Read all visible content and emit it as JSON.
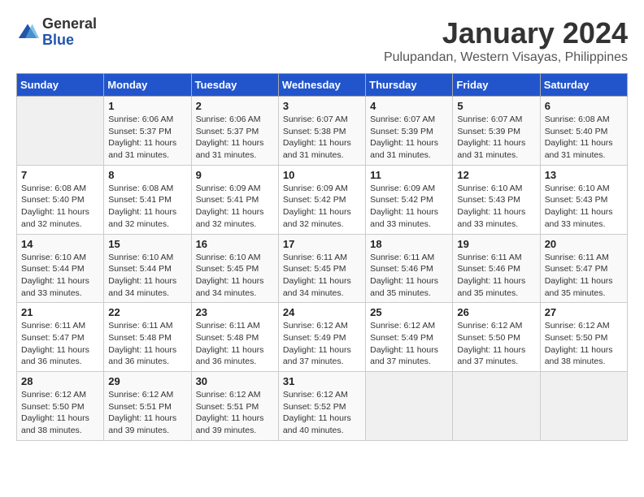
{
  "logo": {
    "general": "General",
    "blue": "Blue"
  },
  "title": {
    "month_year": "January 2024",
    "location": "Pulupandan, Western Visayas, Philippines"
  },
  "days_of_week": [
    "Sunday",
    "Monday",
    "Tuesday",
    "Wednesday",
    "Thursday",
    "Friday",
    "Saturday"
  ],
  "weeks": [
    [
      {
        "day": "",
        "sunrise": "",
        "sunset": "",
        "daylight": ""
      },
      {
        "day": "1",
        "sunrise": "Sunrise: 6:06 AM",
        "sunset": "Sunset: 5:37 PM",
        "daylight": "Daylight: 11 hours and 31 minutes."
      },
      {
        "day": "2",
        "sunrise": "Sunrise: 6:06 AM",
        "sunset": "Sunset: 5:37 PM",
        "daylight": "Daylight: 11 hours and 31 minutes."
      },
      {
        "day": "3",
        "sunrise": "Sunrise: 6:07 AM",
        "sunset": "Sunset: 5:38 PM",
        "daylight": "Daylight: 11 hours and 31 minutes."
      },
      {
        "day": "4",
        "sunrise": "Sunrise: 6:07 AM",
        "sunset": "Sunset: 5:39 PM",
        "daylight": "Daylight: 11 hours and 31 minutes."
      },
      {
        "day": "5",
        "sunrise": "Sunrise: 6:07 AM",
        "sunset": "Sunset: 5:39 PM",
        "daylight": "Daylight: 11 hours and 31 minutes."
      },
      {
        "day": "6",
        "sunrise": "Sunrise: 6:08 AM",
        "sunset": "Sunset: 5:40 PM",
        "daylight": "Daylight: 11 hours and 31 minutes."
      }
    ],
    [
      {
        "day": "7",
        "sunrise": "Sunrise: 6:08 AM",
        "sunset": "Sunset: 5:40 PM",
        "daylight": "Daylight: 11 hours and 32 minutes."
      },
      {
        "day": "8",
        "sunrise": "Sunrise: 6:08 AM",
        "sunset": "Sunset: 5:41 PM",
        "daylight": "Daylight: 11 hours and 32 minutes."
      },
      {
        "day": "9",
        "sunrise": "Sunrise: 6:09 AM",
        "sunset": "Sunset: 5:41 PM",
        "daylight": "Daylight: 11 hours and 32 minutes."
      },
      {
        "day": "10",
        "sunrise": "Sunrise: 6:09 AM",
        "sunset": "Sunset: 5:42 PM",
        "daylight": "Daylight: 11 hours and 32 minutes."
      },
      {
        "day": "11",
        "sunrise": "Sunrise: 6:09 AM",
        "sunset": "Sunset: 5:42 PM",
        "daylight": "Daylight: 11 hours and 33 minutes."
      },
      {
        "day": "12",
        "sunrise": "Sunrise: 6:10 AM",
        "sunset": "Sunset: 5:43 PM",
        "daylight": "Daylight: 11 hours and 33 minutes."
      },
      {
        "day": "13",
        "sunrise": "Sunrise: 6:10 AM",
        "sunset": "Sunset: 5:43 PM",
        "daylight": "Daylight: 11 hours and 33 minutes."
      }
    ],
    [
      {
        "day": "14",
        "sunrise": "Sunrise: 6:10 AM",
        "sunset": "Sunset: 5:44 PM",
        "daylight": "Daylight: 11 hours and 33 minutes."
      },
      {
        "day": "15",
        "sunrise": "Sunrise: 6:10 AM",
        "sunset": "Sunset: 5:44 PM",
        "daylight": "Daylight: 11 hours and 34 minutes."
      },
      {
        "day": "16",
        "sunrise": "Sunrise: 6:10 AM",
        "sunset": "Sunset: 5:45 PM",
        "daylight": "Daylight: 11 hours and 34 minutes."
      },
      {
        "day": "17",
        "sunrise": "Sunrise: 6:11 AM",
        "sunset": "Sunset: 5:45 PM",
        "daylight": "Daylight: 11 hours and 34 minutes."
      },
      {
        "day": "18",
        "sunrise": "Sunrise: 6:11 AM",
        "sunset": "Sunset: 5:46 PM",
        "daylight": "Daylight: 11 hours and 35 minutes."
      },
      {
        "day": "19",
        "sunrise": "Sunrise: 6:11 AM",
        "sunset": "Sunset: 5:46 PM",
        "daylight": "Daylight: 11 hours and 35 minutes."
      },
      {
        "day": "20",
        "sunrise": "Sunrise: 6:11 AM",
        "sunset": "Sunset: 5:47 PM",
        "daylight": "Daylight: 11 hours and 35 minutes."
      }
    ],
    [
      {
        "day": "21",
        "sunrise": "Sunrise: 6:11 AM",
        "sunset": "Sunset: 5:47 PM",
        "daylight": "Daylight: 11 hours and 36 minutes."
      },
      {
        "day": "22",
        "sunrise": "Sunrise: 6:11 AM",
        "sunset": "Sunset: 5:48 PM",
        "daylight": "Daylight: 11 hours and 36 minutes."
      },
      {
        "day": "23",
        "sunrise": "Sunrise: 6:11 AM",
        "sunset": "Sunset: 5:48 PM",
        "daylight": "Daylight: 11 hours and 36 minutes."
      },
      {
        "day": "24",
        "sunrise": "Sunrise: 6:12 AM",
        "sunset": "Sunset: 5:49 PM",
        "daylight": "Daylight: 11 hours and 37 minutes."
      },
      {
        "day": "25",
        "sunrise": "Sunrise: 6:12 AM",
        "sunset": "Sunset: 5:49 PM",
        "daylight": "Daylight: 11 hours and 37 minutes."
      },
      {
        "day": "26",
        "sunrise": "Sunrise: 6:12 AM",
        "sunset": "Sunset: 5:50 PM",
        "daylight": "Daylight: 11 hours and 37 minutes."
      },
      {
        "day": "27",
        "sunrise": "Sunrise: 6:12 AM",
        "sunset": "Sunset: 5:50 PM",
        "daylight": "Daylight: 11 hours and 38 minutes."
      }
    ],
    [
      {
        "day": "28",
        "sunrise": "Sunrise: 6:12 AM",
        "sunset": "Sunset: 5:50 PM",
        "daylight": "Daylight: 11 hours and 38 minutes."
      },
      {
        "day": "29",
        "sunrise": "Sunrise: 6:12 AM",
        "sunset": "Sunset: 5:51 PM",
        "daylight": "Daylight: 11 hours and 39 minutes."
      },
      {
        "day": "30",
        "sunrise": "Sunrise: 6:12 AM",
        "sunset": "Sunset: 5:51 PM",
        "daylight": "Daylight: 11 hours and 39 minutes."
      },
      {
        "day": "31",
        "sunrise": "Sunrise: 6:12 AM",
        "sunset": "Sunset: 5:52 PM",
        "daylight": "Daylight: 11 hours and 40 minutes."
      },
      {
        "day": "",
        "sunrise": "",
        "sunset": "",
        "daylight": ""
      },
      {
        "day": "",
        "sunrise": "",
        "sunset": "",
        "daylight": ""
      },
      {
        "day": "",
        "sunrise": "",
        "sunset": "",
        "daylight": ""
      }
    ]
  ]
}
